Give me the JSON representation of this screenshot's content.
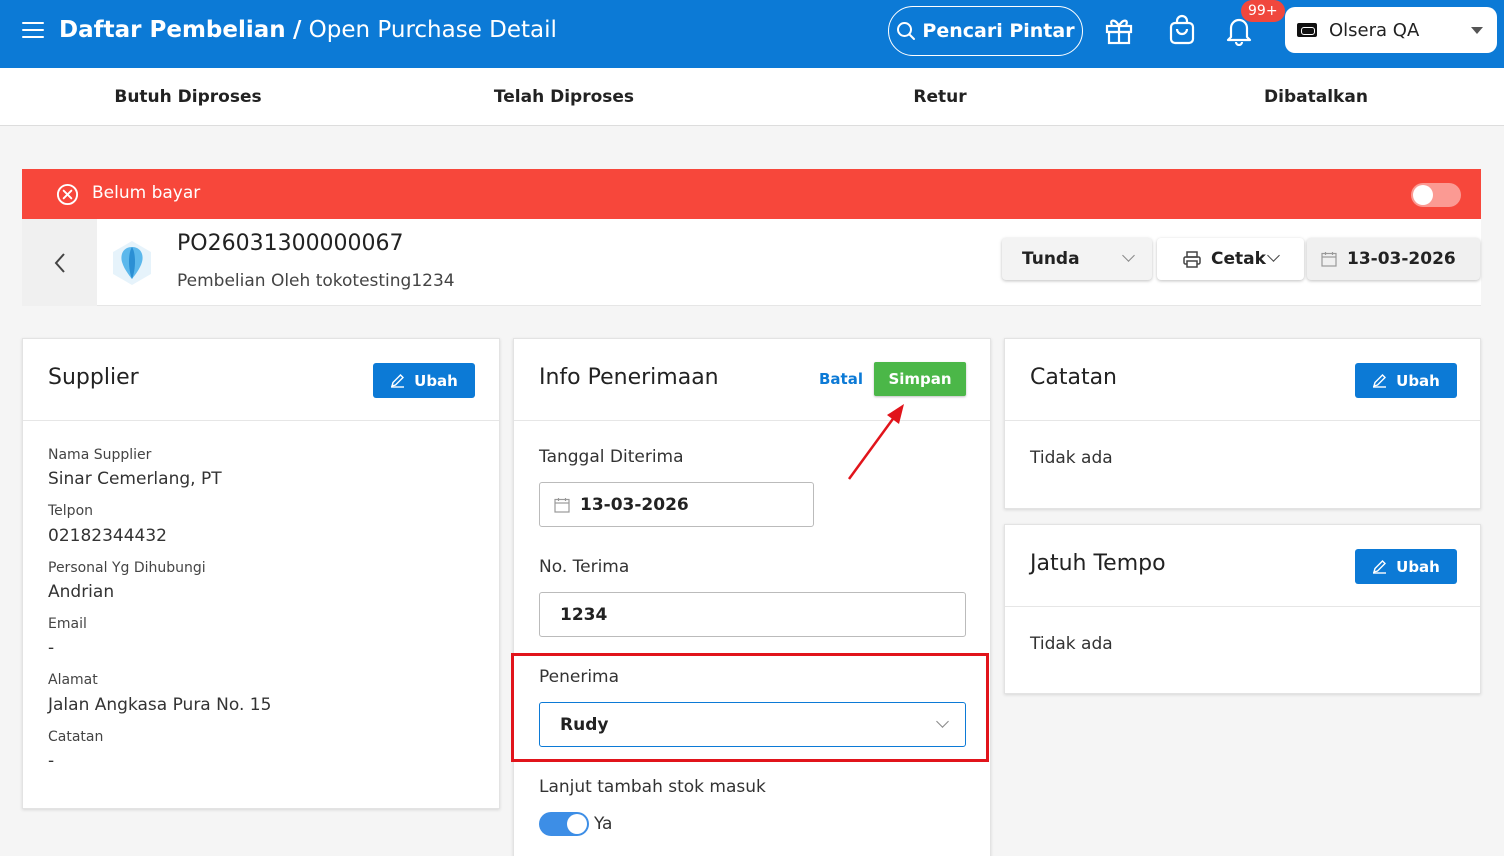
{
  "header": {
    "title_main": "Daftar Pembelian",
    "title_sep": "/",
    "title_sub": "Open Purchase Detail",
    "smart_search": "Pencari Pintar",
    "notif_badge": "99+",
    "store_name": "Olsera QA",
    "icons": [
      "menu-icon",
      "search-icon",
      "gift-icon",
      "bag-icon",
      "bell-icon"
    ]
  },
  "tabs": [
    {
      "label": "Butuh Diproses"
    },
    {
      "label": "Telah Diproses"
    },
    {
      "label": "Retur"
    },
    {
      "label": "Dibatalkan"
    }
  ],
  "status": {
    "label": "Belum bayar",
    "color": "#f7473b"
  },
  "po": {
    "number": "PO26031300000067",
    "subtitle": "Pembelian Oleh tokotesting1234",
    "status_select": "Tunda",
    "print_label": "Cetak",
    "date": "13-03-2026"
  },
  "supplier": {
    "title": "Supplier",
    "edit_label": "Ubah",
    "fields": [
      {
        "label": "Nama Supplier",
        "value": "Sinar Cemerlang, PT"
      },
      {
        "label": "Telpon",
        "value": "02182344432"
      },
      {
        "label": "Personal Yg Dihubungi",
        "value": "Andrian"
      },
      {
        "label": "Email",
        "value": "-"
      },
      {
        "label": "Alamat",
        "value": "Jalan Angkasa Pura No. 15"
      },
      {
        "label": "Catatan",
        "value": "-"
      }
    ]
  },
  "receipt": {
    "title": "Info Penerimaan",
    "cancel_label": "Batal",
    "save_label": "Simpan",
    "date_label": "Tanggal Diterima",
    "date_value": "13-03-2026",
    "number_label": "No. Terima",
    "number_value": "1234",
    "receiver_label": "Penerima",
    "receiver_value": "Rudy",
    "continue_label": "Lanjut tambah stok masuk",
    "continue_value": "Ya"
  },
  "notes": {
    "title": "Catatan",
    "edit_label": "Ubah",
    "value": "Tidak ada"
  },
  "due": {
    "title": "Jatuh Tempo",
    "edit_label": "Ubah",
    "value": "Tidak ada"
  },
  "colors": {
    "primary": "#0c7ad6",
    "danger": "#f7473b",
    "success": "#4bb748",
    "annotation": "#e1141b"
  }
}
